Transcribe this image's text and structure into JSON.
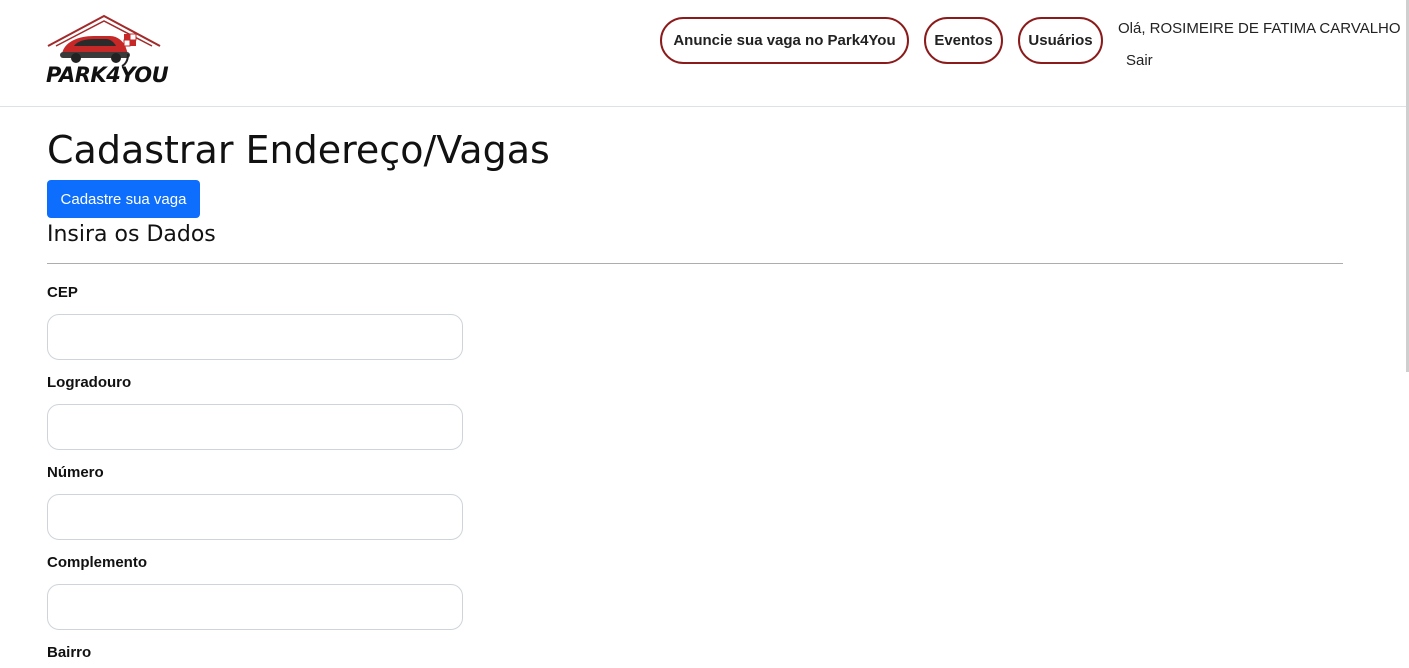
{
  "brand": {
    "logo_text": "PARK4YOU",
    "accent": "#8b1a1a",
    "primary": "#0d6efd"
  },
  "nav": {
    "items": [
      {
        "label": "Anuncie sua vaga no Park4You"
      },
      {
        "label": "Eventos"
      },
      {
        "label": "Usuários"
      }
    ],
    "greeting": "Olá, ROSIMEIRE DE FATIMA CARVALHO",
    "logout_label": "Sair"
  },
  "main": {
    "title": "Cadastrar Endereço/Vagas",
    "button_label": "Cadastre sua vaga",
    "subtitle": "Insira os Dados",
    "fields": [
      {
        "label": "CEP",
        "value": "",
        "placeholder": ""
      },
      {
        "label": "Logradouro",
        "value": "",
        "placeholder": ""
      },
      {
        "label": "Número",
        "value": "",
        "placeholder": ""
      },
      {
        "label": "Complemento",
        "value": "",
        "placeholder": ""
      },
      {
        "label": "Bairro"
      }
    ]
  }
}
